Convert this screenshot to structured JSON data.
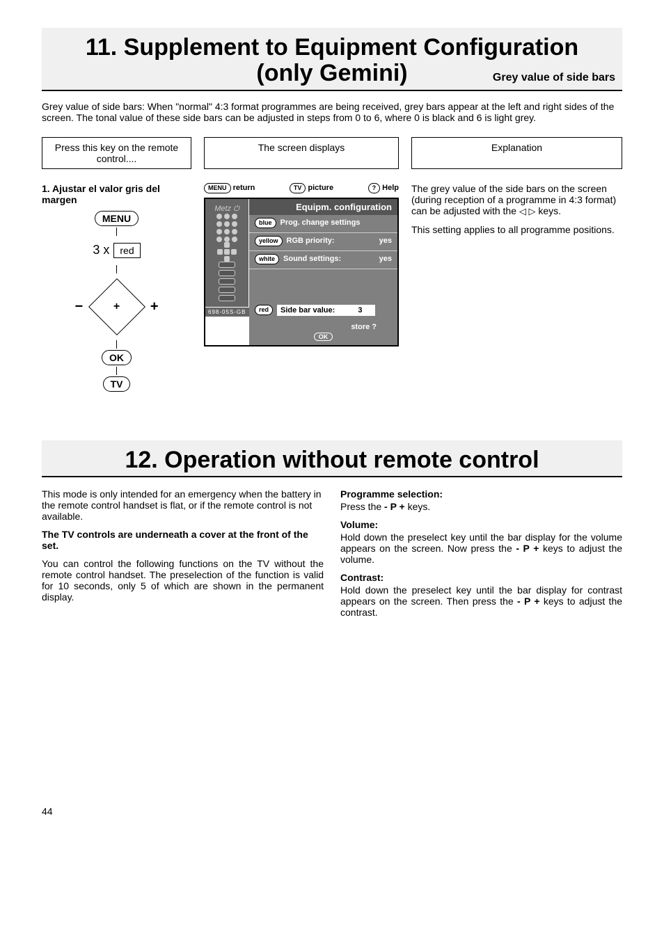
{
  "section11": {
    "title_line1": "11. Supplement to Equipment Configuration",
    "title_line2": "(only Gemini)",
    "title_right": "Grey value of side bars",
    "intro": "Grey value of side bars: When \"normal\" 4:3 format programmes are being received, grey bars appear at the left and right sides of the screen. The tonal value of these side bars can be adjusted in steps from 0 to 6, where 0 is black and 6 is light grey.",
    "col_headers": {
      "press": "Press this key on the remote control....",
      "screen": "The screen displays",
      "explain": "Explanation"
    },
    "step1_title": "1. Ajustar el valor gris del margen",
    "remote": {
      "menu": "MENU",
      "three_x": "3 x",
      "red": "red",
      "minus": "−",
      "plus": "+",
      "ok": "OK",
      "tv": "TV"
    },
    "top_bar": {
      "return_pill": "MENU",
      "return_label": "return",
      "picture_pill": "TV",
      "picture_label": "picture",
      "help_pill": "?",
      "help_label": "Help"
    },
    "screen": {
      "title": "Equipm. configuration",
      "items": [
        {
          "pill": "blue",
          "label": "Prog. change settings",
          "value": ""
        },
        {
          "pill": "yellow",
          "label": "RGB priority:",
          "value": "yes"
        },
        {
          "pill": "white",
          "label": "Sound settings:",
          "value": "yes"
        }
      ],
      "selected": {
        "pill": "red",
        "label": "Side bar value:",
        "value": "3"
      },
      "store": "store ?",
      "ok": "OK",
      "model": "698-05S-GB"
    },
    "explain": {
      "p1a": "The grey value of the side bars on the screen (during reception of a programme in 4:3 format) can be adjusted with the ",
      "p1b": " keys.",
      "p2": "This setting applies to all programme positions."
    }
  },
  "section12": {
    "title": "12. Operation without remote control",
    "left": {
      "p1": "This mode is only intended for an emergency when the battery in the remote control handset is flat, or if the remote control is not available.",
      "p2_bold": "The TV controls are underneath a cover at the front of the set.",
      "p3": "You can control the following functions on the TV without the remote control handset. The preselection of the function is valid for 10 seconds, only 5 of which are shown in the permanent display."
    },
    "right": {
      "h1": "Programme selection:",
      "p1a": "Press the ",
      "p1b": "- P +",
      "p1c": " keys.",
      "h2": "Volume:",
      "p2a": "Hold down the preselect key until the bar display for the volume appears on the screen. Now press the ",
      "p2b": "- P +",
      "p2c": " keys to adjust the volume.",
      "h3": "Contrast:",
      "p3a": "Hold down the preselect key until the bar display for contrast appears on the screen. Then press the ",
      "p3b": "- P +",
      "p3c": " keys to adjust the contrast."
    }
  },
  "page_number": "44"
}
